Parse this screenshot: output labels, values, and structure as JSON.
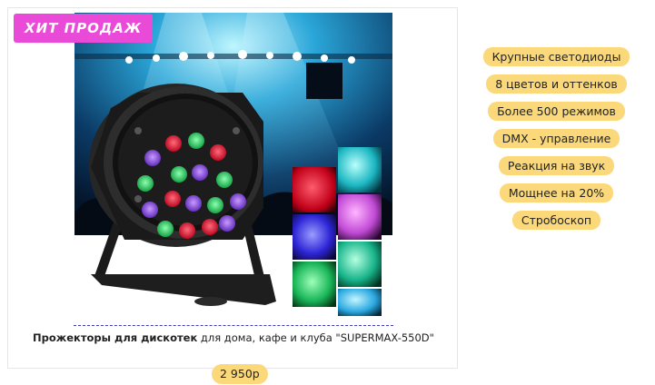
{
  "product": {
    "badge": "ХИТ ПРОДАЖ",
    "title_bold": "Прожекторы для дискотек",
    "title_rest": " для дома, кафе и клуба \"SUPERMAX-550D\"",
    "price": "2 950р"
  },
  "features": [
    "Крупные светодиоды",
    "8 цветов и оттенков",
    "Более 500 режимов",
    "DMX - управление",
    "Реакция на звук",
    "Мощнее на 20%",
    "Стробоскоп"
  ]
}
